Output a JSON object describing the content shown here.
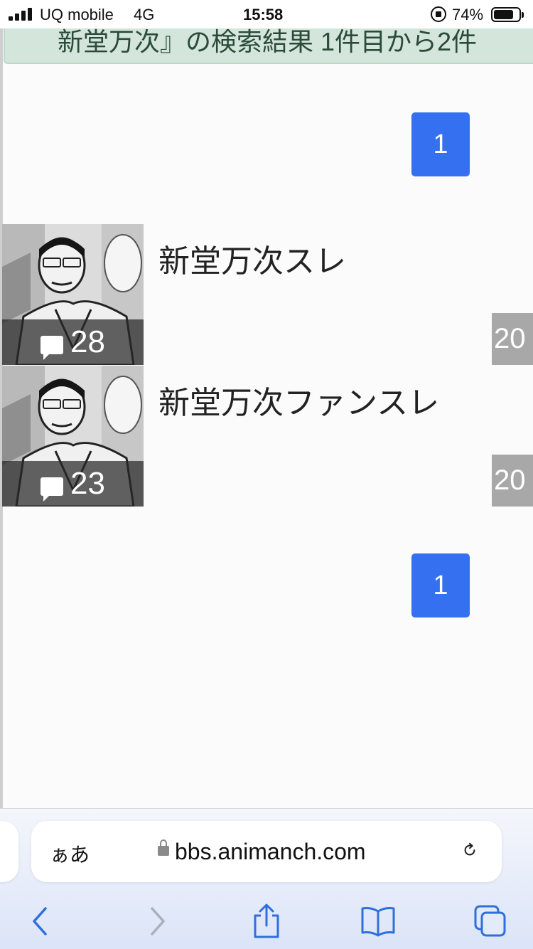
{
  "status_bar": {
    "carrier": "UQ mobile",
    "network": "4G",
    "time": "15:58",
    "battery_percent": "74%",
    "battery_level": 0.74
  },
  "banner": {
    "text": "新堂万次』の検索結果 1件目から2件"
  },
  "pagination": {
    "top_page": "1",
    "bottom_page": "1"
  },
  "threads": [
    {
      "title": "新堂万次スレ",
      "reply_count": "28",
      "date_fragment": "20"
    },
    {
      "title": "新堂万次ファンスレ",
      "reply_count": "23",
      "date_fragment": "20"
    }
  ],
  "browser": {
    "text_size_label": "ぁあ",
    "url": "bbs.animanch.com"
  },
  "colors": {
    "accent": "#3470f0",
    "banner_bg": "#d4e6dc",
    "toolbar_icon": "#2f6fdc"
  }
}
